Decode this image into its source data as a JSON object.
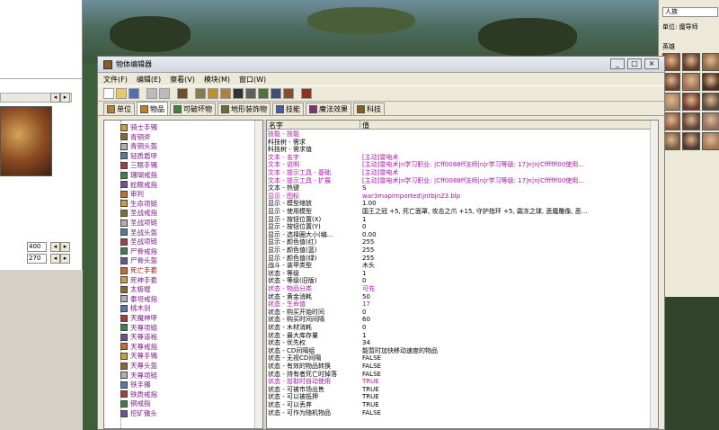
{
  "left_panel": {
    "fields": [
      "400",
      "270"
    ],
    "scroll_arrows": [
      "◂",
      "▸"
    ]
  },
  "right_panel": {
    "race_select": "人族",
    "unit_label": "单位",
    "unit_value": "魔导师",
    "hero_label": "英雄"
  },
  "window": {
    "title": "物体编辑器",
    "controls": [
      "_",
      "□",
      "×"
    ],
    "menu": [
      "文件(F)",
      "编辑(E)",
      "察看(V)",
      "模块(M)",
      "窗口(W)"
    ],
    "tabs": [
      {
        "label": "单位",
        "icon": "unit-icon",
        "color": "#b08040"
      },
      {
        "label": "物品",
        "icon": "item-icon",
        "color": "#c08020"
      },
      {
        "label": "可破坏物",
        "icon": "destructible-icon",
        "color": "#408040"
      },
      {
        "label": "地形装饰物",
        "icon": "doodad-icon",
        "color": "#6a6a40"
      },
      {
        "label": "技能",
        "icon": "ability-icon",
        "color": "#4060a0"
      },
      {
        "label": "魔法效果",
        "icon": "buff-icon",
        "color": "#803080"
      },
      {
        "label": "科技",
        "icon": "upgrade-icon",
        "color": "#806020"
      }
    ],
    "active_tab": "物品"
  },
  "tree_items": [
    {
      "label": "骑士手镯",
      "red": false
    },
    {
      "label": "青铜斧",
      "red": false
    },
    {
      "label": "青铜头盔",
      "red": false
    },
    {
      "label": "轻质盾甲",
      "red": false
    },
    {
      "label": "三眼手镯",
      "red": false
    },
    {
      "label": "珊瑚戒指",
      "red": false
    },
    {
      "label": "蛇眼戒指",
      "red": false
    },
    {
      "label": "审判",
      "red": false
    },
    {
      "label": "生命项链",
      "red": false
    },
    {
      "label": "圣战戒指",
      "red": false
    },
    {
      "label": "圣战项链",
      "red": false
    },
    {
      "label": "圣战头盔",
      "red": false
    },
    {
      "label": "圣战项链",
      "red": false
    },
    {
      "label": "尸骨戒指",
      "red": false
    },
    {
      "label": "尸骨头盔",
      "red": false
    },
    {
      "label": "死亡手套",
      "red": true
    },
    {
      "label": "死神手套",
      "red": false
    },
    {
      "label": "太极棍",
      "red": false
    },
    {
      "label": "泰坦戒指",
      "red": false
    },
    {
      "label": "桃木剑",
      "red": false
    },
    {
      "label": "天魔神甲",
      "red": false
    },
    {
      "label": "天尊项链",
      "red": false
    },
    {
      "label": "天尊道袍",
      "red": false
    },
    {
      "label": "天尊戒指",
      "red": false
    },
    {
      "label": "天尊手镯",
      "red": false
    },
    {
      "label": "天尊头盔",
      "red": false
    },
    {
      "label": "天尊项链",
      "red": false
    },
    {
      "label": "铁手镯",
      "red": false
    },
    {
      "label": "铁质戒指",
      "red": false
    },
    {
      "label": "铜戒指",
      "red": false
    },
    {
      "label": "挖矿锄头",
      "red": false
    }
  ],
  "grid": {
    "header_name": "名字",
    "header_value": "值",
    "rows": [
      {
        "name": "技能 - 技能",
        "value": "",
        "purple": true
      },
      {
        "name": "科技树 - 需求",
        "value": "",
        "purple": false
      },
      {
        "name": "科技树 - 需求值",
        "value": "",
        "purple": false
      },
      {
        "name": "文本 - 名字",
        "value": "[主动]雷电术",
        "purple": true
      },
      {
        "name": "文本 - 说明",
        "value": "[主动]雷电术|n学习职业: |Cff0088ff法师|n|r学习等级: 17|n|n|Cffffff00使用...",
        "purple": true
      },
      {
        "name": "文本 - 提示工具 - 基础",
        "value": "[主动]雷电术",
        "purple": true
      },
      {
        "name": "文本 - 提示工具 - 扩展",
        "value": "[主动]雷电术|n学习职业: |Cff0088ff法师|n|r学习等级: 17|n|n|Cffffff00使用...",
        "purple": true
      },
      {
        "name": "文本 - 热键",
        "value": "S",
        "purple": false
      },
      {
        "name": "显示 - 图标",
        "value": "war3mapImported\\jntbjn23.blp",
        "purple": true
      },
      {
        "name": "显示 - 模型缩放",
        "value": "1.00",
        "purple": false
      },
      {
        "name": "显示 - 使用模型",
        "value": "国王之冠 +5, 死亡面罩, 攻击之爪 +15, 守护指环 +5, 霜冻之球, 恶魔雕像, 恶...",
        "purple": false
      },
      {
        "name": "显示 - 按钮位置(X)",
        "value": "1",
        "purple": false
      },
      {
        "name": "显示 - 按钮位置(Y)",
        "value": "0",
        "purple": false
      },
      {
        "name": "显示 - 选择圈大小(编...",
        "value": "0.00",
        "purple": false
      },
      {
        "name": "显示 - 颜色值(红)",
        "value": "255",
        "purple": false
      },
      {
        "name": "显示 - 颜色值(蓝)",
        "value": "255",
        "purple": false
      },
      {
        "name": "显示 - 颜色值(绿)",
        "value": "255",
        "purple": false
      },
      {
        "name": "战斗 - 装甲类型",
        "value": "木头",
        "purple": false
      },
      {
        "name": "状态 - 等级",
        "value": "1",
        "purple": false
      },
      {
        "name": "状态 - 等级(旧版)",
        "value": "0",
        "purple": false
      },
      {
        "name": "状态 - 物品分类",
        "value": "可充",
        "purple": true
      },
      {
        "name": "状态 - 黄金消耗",
        "value": "50",
        "purple": false
      },
      {
        "name": "状态 - 生命值",
        "value": "17",
        "purple": true
      },
      {
        "name": "状态 - 购买开始时间",
        "value": "0",
        "purple": false
      },
      {
        "name": "状态 - 购买时间间隔",
        "value": "60",
        "purple": false
      },
      {
        "name": "状态 - 木材消耗",
        "value": "0",
        "purple": false
      },
      {
        "name": "状态 - 最大库存量",
        "value": "1",
        "purple": false
      },
      {
        "name": "状态 - 优先权",
        "value": "34",
        "purple": false
      },
      {
        "name": "状态 - CD间隔组",
        "value": "能暂时加快移动速度的物品",
        "purple": false
      },
      {
        "name": "状态 - 无视CD间隔",
        "value": "FALSE",
        "purple": false
      },
      {
        "name": "状态 - 有效的物品转换",
        "value": "FALSE",
        "purple": false
      },
      {
        "name": "状态 - 持有者死亡时掉落",
        "value": "FALSE",
        "purple": false
      },
      {
        "name": "状态 - 拾取时自动使用",
        "value": "TRUE",
        "purple": true
      },
      {
        "name": "状态 - 可被市场出售",
        "value": "TRUE",
        "purple": false
      },
      {
        "name": "状态 - 可以被抵押",
        "value": "TRUE",
        "purple": false
      },
      {
        "name": "状态 - 可以丢弃",
        "value": "TRUE",
        "purple": false
      },
      {
        "name": "状态 - 可作为随机物品",
        "value": "FALSE",
        "purple": false
      }
    ]
  }
}
